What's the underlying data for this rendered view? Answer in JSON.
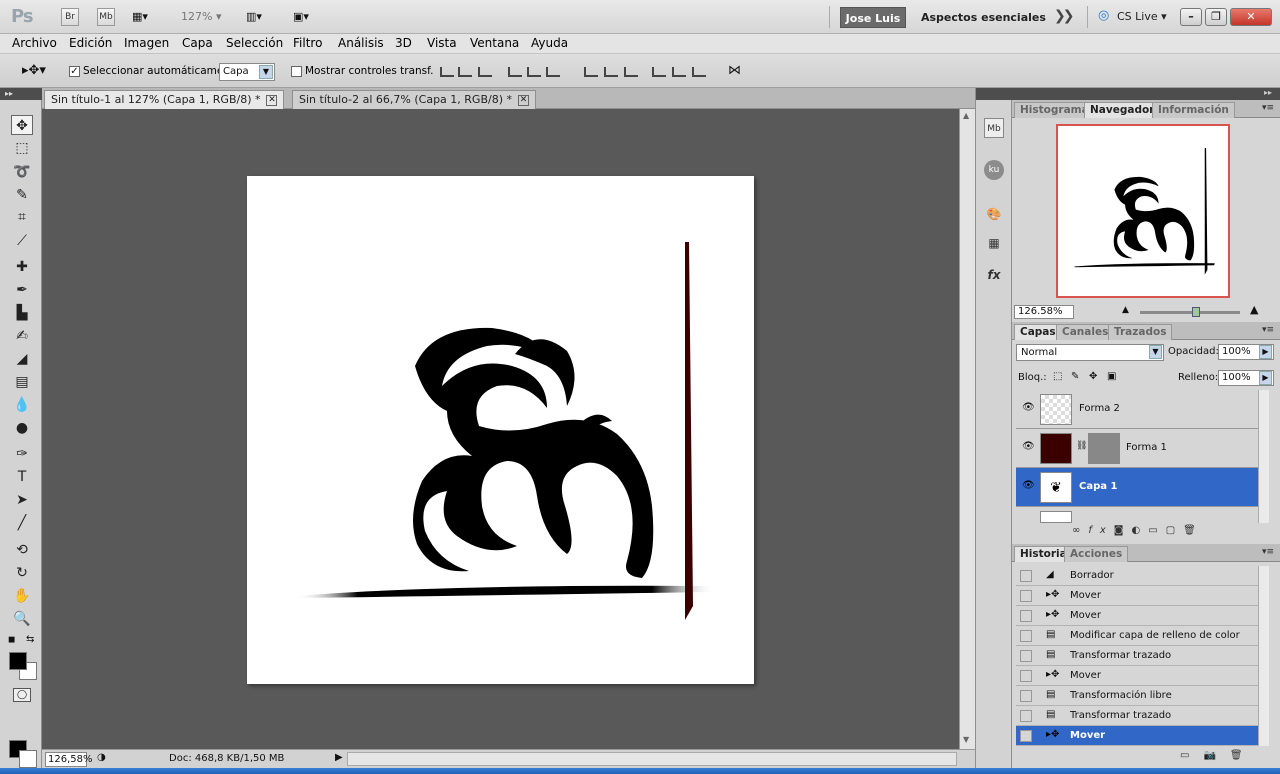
{
  "app": {
    "logo": "Ps",
    "bridge_btn": "Br",
    "minibridge_btn": "Mb",
    "zoom_level": "127%",
    "user_name": "Jose Luis",
    "workspace": "Aspectos esenciales",
    "cs_live": "CS Live"
  },
  "menu": [
    "Archivo",
    "Edición",
    "Imagen",
    "Capa",
    "Selección",
    "Filtro",
    "Análisis",
    "3D",
    "Vista",
    "Ventana",
    "Ayuda"
  ],
  "options": {
    "auto_select_label": "Seleccionar automáticamente:",
    "auto_select_value": "Capa",
    "show_transform_label": "Mostrar controles transf."
  },
  "tabs": [
    {
      "label": "Sin título-1 al 127% (Capa 1, RGB/8) *"
    },
    {
      "label": "Sin título-2 al 66,7% (Capa 1, RGB/8) *"
    }
  ],
  "status": {
    "zoom": "126,58%",
    "doc": "Doc: 468,8 KB/1,50 MB"
  },
  "panels": {
    "nav_tabs": [
      "Histograma",
      "Navegador",
      "Información"
    ],
    "nav_zoom": "126.58%",
    "layer_tabs": [
      "Capas",
      "Canales",
      "Trazados"
    ],
    "blend_mode": "Normal",
    "opacity_label": "Opacidad:",
    "opacity": "100%",
    "lock_label": "Bloq.:",
    "fill_label": "Relleno:",
    "fill": "100%",
    "layers": [
      {
        "name": "Forma 2"
      },
      {
        "name": "Forma 1"
      },
      {
        "name": "Capa 1"
      }
    ],
    "history_tabs": [
      "Historia",
      "Acciones"
    ],
    "history": [
      "Borrador",
      "Mover",
      "Mover",
      "Modificar capa de relleno de color",
      "Transformar trazado",
      "Mover",
      "Transformación libre",
      "Transformar trazado",
      "Mover"
    ]
  },
  "side_icons": {
    "mb": "Mb",
    "ku": "ku"
  }
}
